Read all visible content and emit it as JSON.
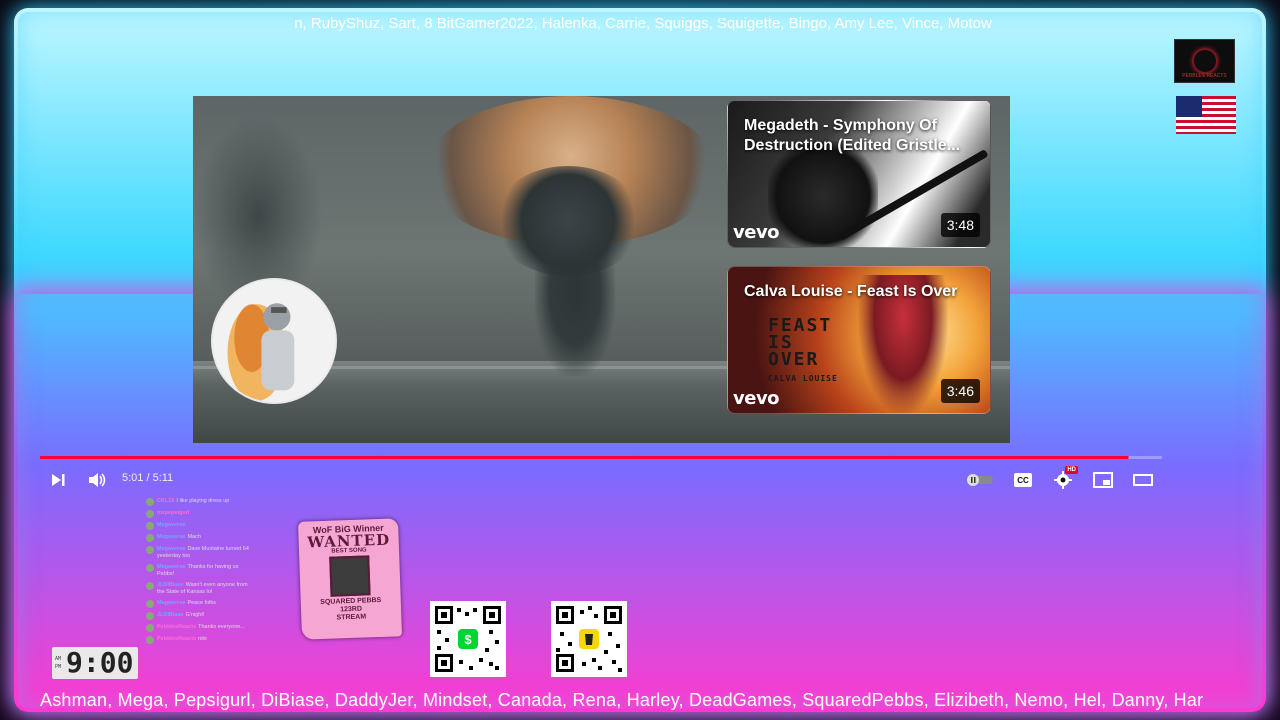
{
  "ticker_top": "n, RubyShuz, Sart, 8 BitGamer2022, Halenka, Carrie, Squiggs, Squigette, Bingo, Amy Lee, Vince, Motow",
  "ticker_bottom": "Ashman, Mega, Pepsigurl, DiBiase, DaddyJer, Mindset, Canada, Rena, Harley, DeadGames, SquaredPebbs, Elizibeth, Nemo, Hel, Danny, Har",
  "brand_logo_text": "PEBBLES REACTS",
  "end_screen": {
    "cards": [
      {
        "title": "Megadeth - Symphony Of Destruction (Edited Gristle...",
        "duration": "3:48",
        "label": "vevo"
      },
      {
        "title": "Calva Louise - Feast Is Over",
        "duration": "3:46",
        "label": "vevo",
        "art_line1": "FEAST",
        "art_line2": "IS",
        "art_line3": "OVER",
        "art_sub": "CALVA LOUISE"
      }
    ]
  },
  "player": {
    "time": "5:01 / 5:11",
    "progress_fraction": 0.97,
    "hd_badge": "HD",
    "accent_color": "#ff0033"
  },
  "chat": [
    {
      "user": "CKL16",
      "text": "I like playing dress up"
    },
    {
      "user": "mzpepsigurl",
      "text": ""
    },
    {
      "user": "Megaverse",
      "text": ""
    },
    {
      "user": "Megaverse",
      "text": "Mach"
    },
    {
      "user": "Megaverse",
      "text": "Dave Mustaine turned 64 yesterday too"
    },
    {
      "user": "Megaverse",
      "text": "Thanks for having us Pebbs!"
    },
    {
      "user": "JLDiBiase",
      "text": "Wasn't even anyone from the State of Kansas lol"
    },
    {
      "user": "Megaverse",
      "text": "Peace folks"
    },
    {
      "user": "JLDiBiase",
      "text": "G'night!"
    },
    {
      "user": "PebblesReacts",
      "text": "Thanks everyone..."
    },
    {
      "user": "PebblesReacts",
      "text": "nite"
    }
  ],
  "poster": {
    "line1": "WoF BiG Winner",
    "line2": "WANTED",
    "line3": "BEST SONG",
    "line4": "SQUARED PEBBS",
    "line5": "123RD",
    "line6": "STREAM"
  },
  "qr_codes": [
    {
      "name": "cashapp",
      "icon": "dollar-icon",
      "color": "#00d632"
    },
    {
      "name": "tip-jar",
      "icon": "cup-icon",
      "color": "#f5d800"
    }
  ],
  "clock": {
    "time": "9:00",
    "am": "AM",
    "pm": "PM"
  }
}
